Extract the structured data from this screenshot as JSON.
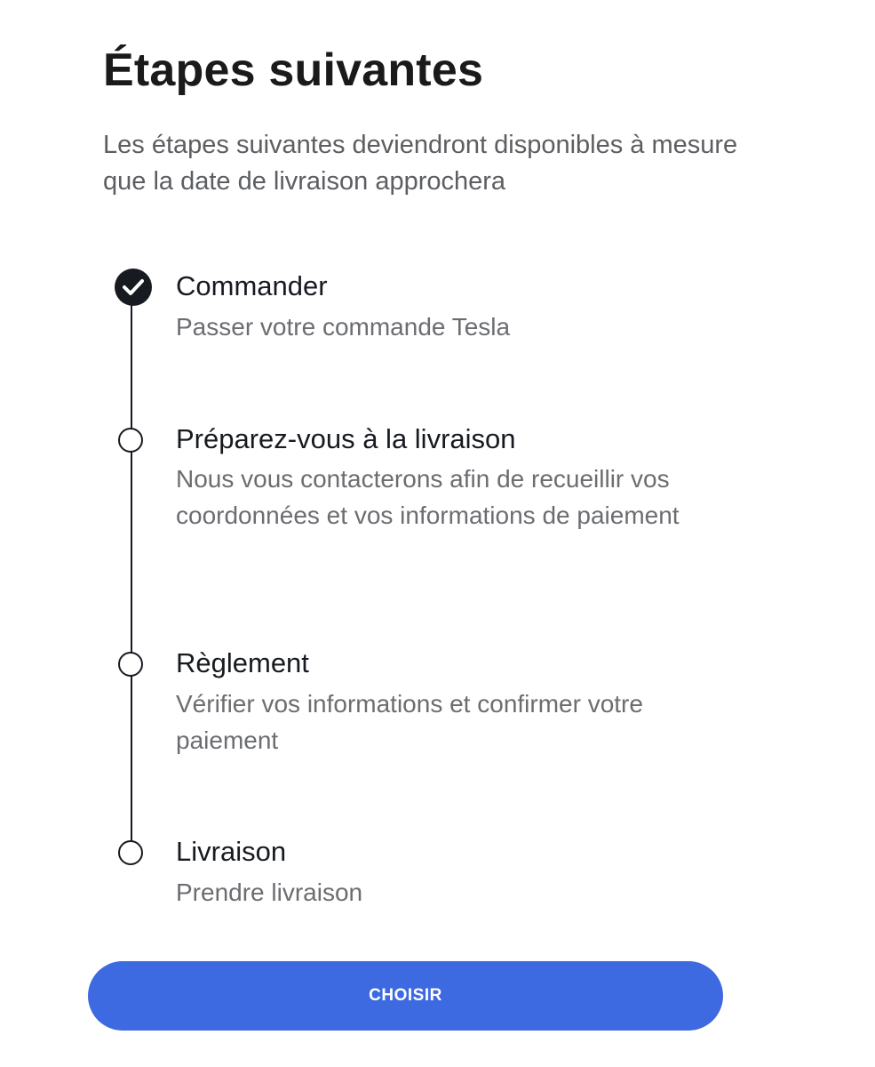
{
  "header": {
    "title": "Étapes suivantes",
    "subtitle": "Les étapes suivantes deviendront disponibles à mesure que la date de livraison approchera"
  },
  "steps": [
    {
      "title": "Commander",
      "description": "Passer votre commande Tesla",
      "status": "completed",
      "icon": "check-circle-icon"
    },
    {
      "title": "Préparez-vous à la livraison",
      "description": "Nous vous contacterons afin de recueillir vos coordonnées et vos informations de paiement",
      "status": "pending",
      "icon": "empty-circle-icon"
    },
    {
      "title": "Règlement",
      "description": "Vérifier vos informations et confirmer votre paiement",
      "status": "pending",
      "icon": "empty-circle-icon"
    },
    {
      "title": "Livraison",
      "description": "Prendre livraison",
      "status": "pending",
      "icon": "empty-circle-icon"
    }
  ],
  "actions": {
    "choose_label": "CHOISIR"
  },
  "colors": {
    "accent": "#3e6ae1",
    "text_primary": "#171a20",
    "text_secondary": "#5c5e62"
  }
}
